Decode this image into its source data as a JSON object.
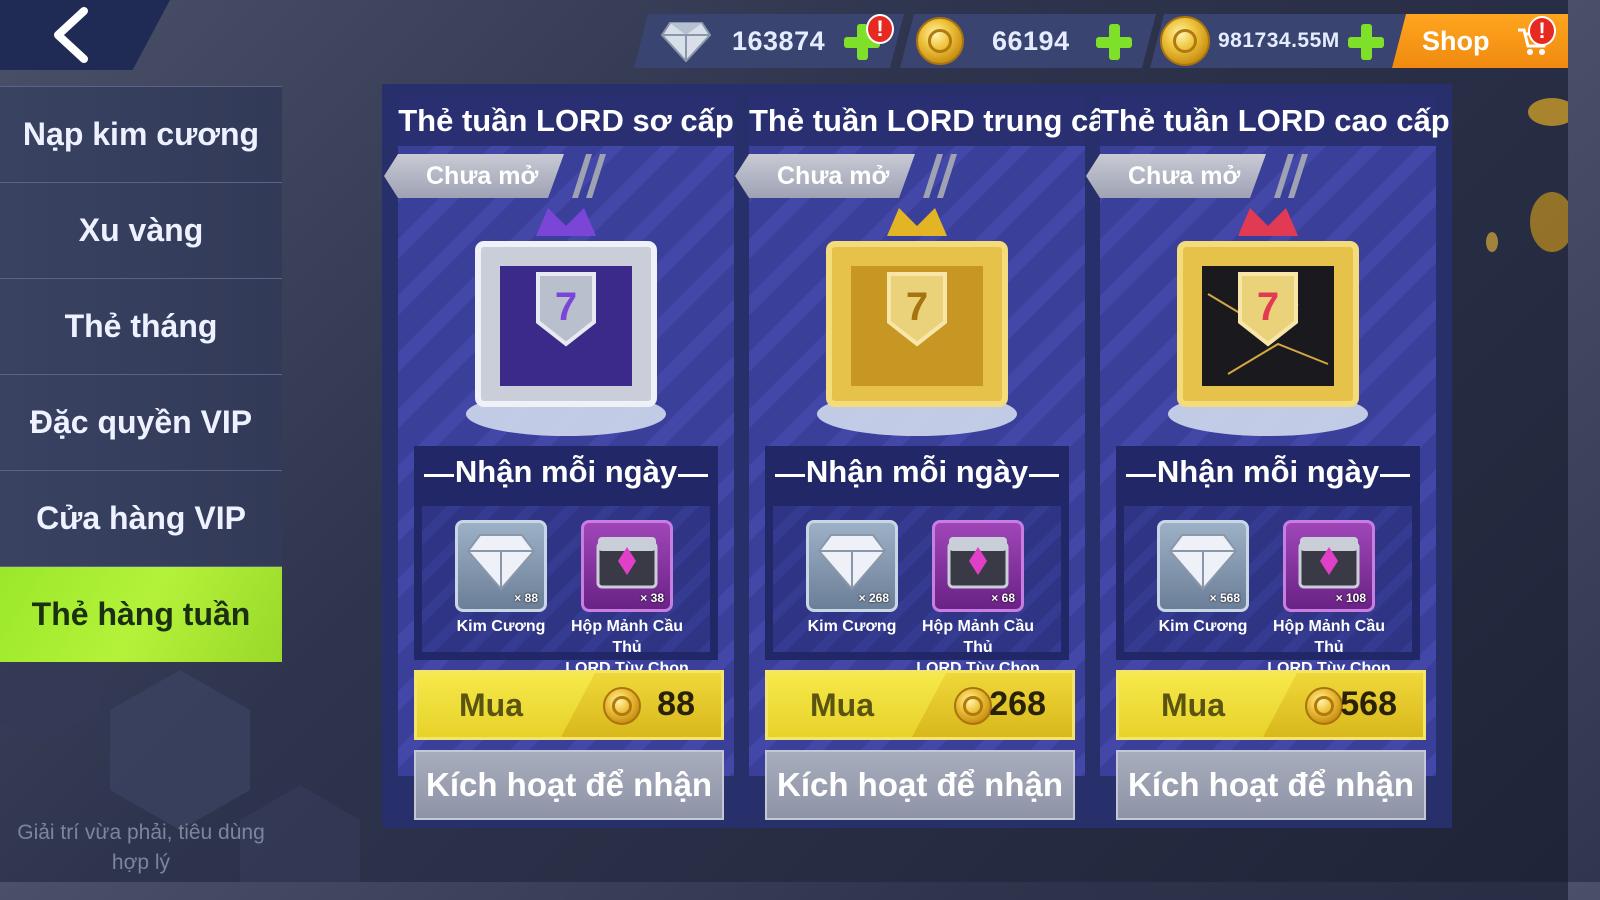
{
  "topbar": {
    "back_icon": "chevron-left-icon",
    "gems": "163874",
    "coins": "66194",
    "tokens": "981734.55M",
    "shop_label": "Shop",
    "alert_mark": "!"
  },
  "sidebar": {
    "items": [
      {
        "label": "Nạp kim cương"
      },
      {
        "label": "Xu vàng"
      },
      {
        "label": "Thẻ tháng"
      },
      {
        "label": "Đặc quyền VIP"
      },
      {
        "label": "Cửa hàng VIP"
      },
      {
        "label": "Thẻ hàng tuần",
        "active": true
      }
    ],
    "footer_line1": "Giải trí vừa phải, tiêu dùng",
    "footer_line2": "hợp lý"
  },
  "cards": [
    {
      "title": "Thẻ tuần LORD sơ cấp",
      "status": "Chưa mở",
      "daily_title": "Nhận mỗi ngày",
      "reward1_name": "Kim Cương",
      "reward1_qty": "× 88",
      "reward2_name_line1": "Hộp Mảnh Cầu Thủ",
      "reward2_name_line2": "LORD Tùy Chọn",
      "reward2_qty": "× 38",
      "buy_label": "Mua",
      "price": "88",
      "activate_label": "Kích hoạt để nhận",
      "tier_color": "#7b46d8"
    },
    {
      "title": "Thẻ tuần LORD trung cấp",
      "status": "Chưa mở",
      "daily_title": "Nhận mỗi ngày",
      "reward1_name": "Kim Cương",
      "reward1_qty": "× 268",
      "reward2_name_line1": "Hộp Mảnh Cầu Thủ",
      "reward2_name_line2": "LORD Tùy Chọn",
      "reward2_qty": "× 68",
      "buy_label": "Mua",
      "price": "268",
      "activate_label": "Kích hoạt để nhận",
      "tier_color": "#e3b423"
    },
    {
      "title": "Thẻ tuần LORD cao cấp",
      "status": "Chưa mở",
      "daily_title": "Nhận mỗi ngày",
      "reward1_name": "Kim Cương",
      "reward1_qty": "× 568",
      "reward2_name_line1": "Hộp Mảnh Cầu Thủ",
      "reward2_name_line2": "LORD Tùy Chọn",
      "reward2_qty": "× 108",
      "buy_label": "Mua",
      "price": "568",
      "activate_label": "Kích hoạt để nhận",
      "tier_color": "#e23a52"
    }
  ]
}
